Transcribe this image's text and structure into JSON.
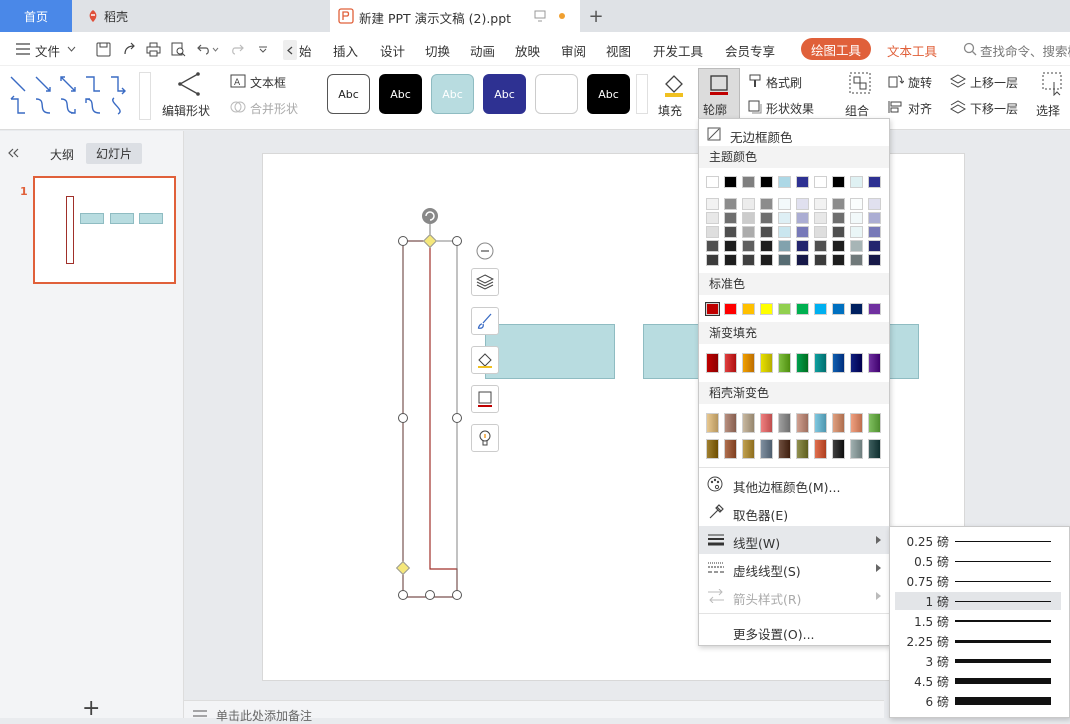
{
  "titlebar": {
    "home_tab": "首页",
    "daoke_tab": "稻壳",
    "doc_tab": "新建 PPT 演示文稿 (2).ppt",
    "new_tab": "+"
  },
  "menubar": {
    "file": "文件",
    "items": [
      "始",
      "插入",
      "设计",
      "切换",
      "动画",
      "放映",
      "审阅",
      "视图",
      "开发工具",
      "会员专享"
    ],
    "drawing_tools": "绘图工具",
    "text_tools": "文本工具",
    "search_placeholder": "查找命令、搜索模"
  },
  "ribbon": {
    "edit_shape": "编辑形状",
    "textbox": "文本框",
    "merge_shape": "合并形状",
    "style_label": "Abc",
    "fill": "填充",
    "outline": "轮廓",
    "format_brush": "格式刷",
    "shape_effect": "形状效果",
    "group": "组合",
    "rotate": "旋转",
    "align": "对齐",
    "bring_forward": "上移一层",
    "send_backward": "下移一层",
    "select": "选择"
  },
  "leftpane": {
    "outline_tab": "大纲",
    "slides_tab": "幻灯片",
    "slide_number": "1",
    "add": "+"
  },
  "notes": "单击此处添加备注",
  "dropdown": {
    "no_border": "无边框颜色",
    "theme_colors": "主题颜色",
    "standard_colors": "标准色",
    "gradient_fill": "渐变填充",
    "daoke_gradient": "稻壳渐变色",
    "more_colors": "其他边框颜色(M)...",
    "eyedropper": "取色器(E)",
    "line_type": "线型(W)",
    "dash_type": "虚线线型(S)",
    "arrow_style": "箭头样式(R)",
    "more_settings": "更多设置(O)...",
    "theme_top_row": [
      "#ffffff",
      "#000000",
      "#7f7f7f",
      "#000000",
      "#add8e6",
      "#2e3192",
      "#ffffff",
      "#000000",
      "#dff1f3",
      "#2e3192"
    ],
    "standard_row": [
      "#c00000",
      "#ff0000",
      "#ffc000",
      "#ffff00",
      "#92d050",
      "#00b050",
      "#00b0f0",
      "#0070c0",
      "#002060",
      "#7030a0"
    ],
    "gradient_row": [
      "#c00000",
      "#e04040",
      "#f0a000",
      "#e8e000",
      "#80c040",
      "#00a050",
      "#10a0a0",
      "#1060b0",
      "#102080",
      "#7030a0"
    ],
    "daoke_row1": [
      "#e8c890",
      "#b89080",
      "#c8b8a0",
      "#f08080",
      "#a0a0a0",
      "#d0a090",
      "#80c8e0",
      "#e0a080",
      "#f0a080",
      "#80c060"
    ],
    "daoke_row2": [
      "#a08030",
      "#b07050",
      "#c0a050",
      "#8090a0",
      "#705040",
      "#909050",
      "#e07050",
      "#404040",
      "#a0b0b0",
      "#406060"
    ]
  },
  "submenu": {
    "widths": [
      {
        "label": "0.25 磅",
        "pt": 0.25
      },
      {
        "label": "0.5 磅",
        "pt": 0.5
      },
      {
        "label": "0.75 磅",
        "pt": 0.75
      },
      {
        "label": "1 磅",
        "pt": 1
      },
      {
        "label": "1.5 磅",
        "pt": 1.5
      },
      {
        "label": "2.25 磅",
        "pt": 2.25
      },
      {
        "label": "3 磅",
        "pt": 3
      },
      {
        "label": "4.5 磅",
        "pt": 4.5
      },
      {
        "label": "6 磅",
        "pt": 6
      }
    ],
    "selected": "1 磅"
  },
  "colors": {
    "accent_orange": "#e0603a",
    "home_blue": "#4a88e8",
    "shape_fill": "#b8dce0",
    "outline_red": "#a0302a"
  }
}
